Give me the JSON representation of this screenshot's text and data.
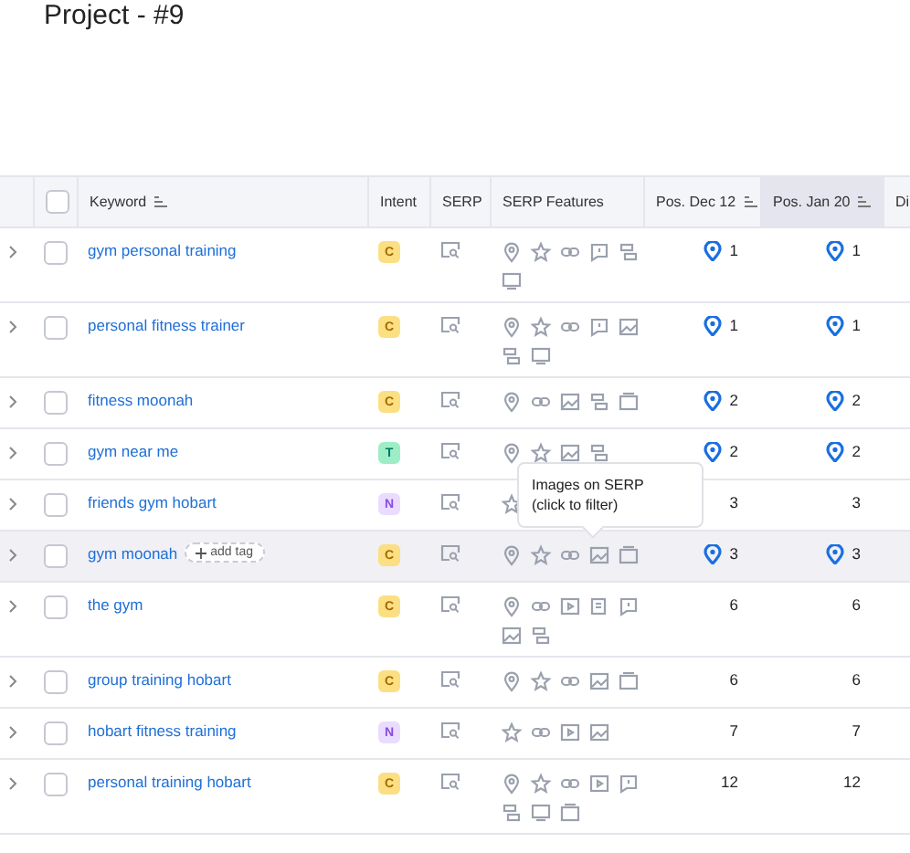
{
  "title": "Project - #9",
  "table": {
    "select_all": {
      "checked": false
    },
    "columns": [
      {
        "label": "Keyword",
        "sortable": true,
        "selected": false
      },
      {
        "label": "Intent",
        "sortable": false,
        "selected": false
      },
      {
        "label": "SERP",
        "sortable": false,
        "selected": false
      },
      {
        "label": "SERP Features",
        "sortable": false,
        "selected": false
      },
      {
        "label": "Pos. Dec 12",
        "sortable": true,
        "selected": false
      },
      {
        "label": "Pos. Jan 20",
        "sortable": true,
        "selected": true
      },
      {
        "label": "Di",
        "sortable": false,
        "selected": false
      }
    ],
    "rows": [
      {
        "keyword": "gym personal training",
        "checked": false,
        "hovered": false,
        "intent": {
          "kind": "commercial",
          "letter": "C"
        },
        "features": [
          {
            "kind": "local"
          },
          {
            "kind": "star"
          },
          {
            "kind": "link"
          },
          {
            "kind": "review"
          },
          {
            "kind": "sitelinks"
          },
          {
            "kind": "screen"
          }
        ],
        "pos_1": {
          "value": "1",
          "local": true
        },
        "pos_2": {
          "value": "1",
          "local": true
        }
      },
      {
        "keyword": "personal fitness trainer",
        "checked": false,
        "hovered": false,
        "intent": {
          "kind": "commercial",
          "letter": "C"
        },
        "features": [
          {
            "kind": "local"
          },
          {
            "kind": "star"
          },
          {
            "kind": "link"
          },
          {
            "kind": "review"
          },
          {
            "kind": "images"
          },
          {
            "kind": "sitelinks"
          },
          {
            "kind": "screen"
          }
        ],
        "pos_1": {
          "value": "1",
          "local": true
        },
        "pos_2": {
          "value": "1",
          "local": true
        }
      },
      {
        "keyword": "fitness moonah",
        "checked": false,
        "hovered": false,
        "intent": {
          "kind": "commercial",
          "letter": "C"
        },
        "features": [
          {
            "kind": "local"
          },
          {
            "kind": "link"
          },
          {
            "kind": "images"
          },
          {
            "kind": "sitelinks"
          },
          {
            "kind": "carousel"
          }
        ],
        "pos_1": {
          "value": "2",
          "local": true
        },
        "pos_2": {
          "value": "2",
          "local": true
        }
      },
      {
        "keyword": "gym near me",
        "checked": false,
        "hovered": false,
        "intent": {
          "kind": "transactional",
          "letter": "T"
        },
        "features": [
          {
            "kind": "local"
          },
          {
            "kind": "star"
          },
          {
            "kind": "images"
          },
          {
            "kind": "sitelinks"
          }
        ],
        "pos_1": {
          "value": "2",
          "local": true
        },
        "pos_2": {
          "value": "2",
          "local": true
        }
      },
      {
        "keyword": "friends gym hobart",
        "checked": false,
        "hovered": false,
        "intent": {
          "kind": "navigational",
          "letter": "N"
        },
        "features": [
          {
            "kind": "star"
          }
        ],
        "pos_1": {
          "value": "3",
          "local": false
        },
        "pos_2": {
          "value": "3",
          "local": false
        }
      },
      {
        "keyword": "gym moonah",
        "checked": false,
        "hovered": true,
        "add_tag": "add tag",
        "intent": {
          "kind": "commercial",
          "letter": "C"
        },
        "features": [
          {
            "kind": "local"
          },
          {
            "kind": "star"
          },
          {
            "kind": "link"
          },
          {
            "kind": "images"
          },
          {
            "kind": "carousel"
          }
        ],
        "pos_1": {
          "value": "3",
          "local": true
        },
        "pos_2": {
          "value": "3",
          "local": true
        }
      },
      {
        "keyword": "the gym",
        "checked": false,
        "hovered": false,
        "intent": {
          "kind": "commercial",
          "letter": "C"
        },
        "features": [
          {
            "kind": "local"
          },
          {
            "kind": "link"
          },
          {
            "kind": "video"
          },
          {
            "kind": "article"
          },
          {
            "kind": "review"
          },
          {
            "kind": "images"
          },
          {
            "kind": "sitelinks"
          }
        ],
        "pos_1": {
          "value": "6",
          "local": false
        },
        "pos_2": {
          "value": "6",
          "local": false
        }
      },
      {
        "keyword": "group training hobart",
        "checked": false,
        "hovered": false,
        "intent": {
          "kind": "commercial",
          "letter": "C"
        },
        "features": [
          {
            "kind": "local"
          },
          {
            "kind": "star"
          },
          {
            "kind": "link"
          },
          {
            "kind": "images"
          },
          {
            "kind": "carousel"
          }
        ],
        "pos_1": {
          "value": "6",
          "local": false
        },
        "pos_2": {
          "value": "6",
          "local": false
        }
      },
      {
        "keyword": "hobart fitness training",
        "checked": false,
        "hovered": false,
        "intent": {
          "kind": "navigational",
          "letter": "N"
        },
        "features": [
          {
            "kind": "star"
          },
          {
            "kind": "link"
          },
          {
            "kind": "video"
          },
          {
            "kind": "images"
          }
        ],
        "pos_1": {
          "value": "7",
          "local": false
        },
        "pos_2": {
          "value": "7",
          "local": false
        }
      },
      {
        "keyword": "personal training hobart",
        "checked": false,
        "hovered": false,
        "intent": {
          "kind": "commercial",
          "letter": "C"
        },
        "features": [
          {
            "kind": "local"
          },
          {
            "kind": "star"
          },
          {
            "kind": "link"
          },
          {
            "kind": "video"
          },
          {
            "kind": "review"
          },
          {
            "kind": "sitelinks"
          },
          {
            "kind": "screen"
          },
          {
            "kind": "carousel"
          }
        ],
        "pos_1": {
          "value": "12",
          "local": false
        },
        "pos_2": {
          "value": "12",
          "local": false
        }
      }
    ]
  },
  "tooltip": {
    "lines": [
      "Images on SERP",
      "(click to filter)"
    ]
  }
}
